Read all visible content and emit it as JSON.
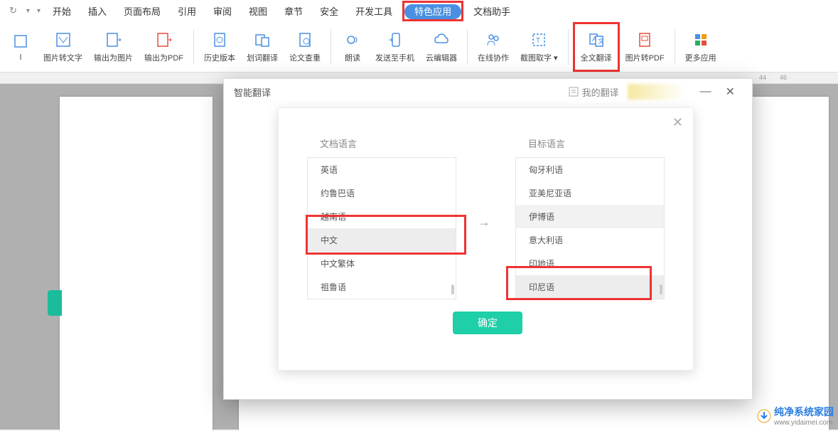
{
  "menu": {
    "items": [
      "开始",
      "插入",
      "页面布局",
      "引用",
      "审阅",
      "视图",
      "章节",
      "安全",
      "开发工具",
      "特色应用",
      "文档助手"
    ],
    "highlighted_index": 9
  },
  "ribbon": {
    "buttons": [
      {
        "label": "图片转文字",
        "icon": "image-text"
      },
      {
        "label": "输出为图片",
        "icon": "export-image"
      },
      {
        "label": "输出为PDF",
        "icon": "export-pdf"
      },
      {
        "label": "历史版本",
        "icon": "history"
      },
      {
        "label": "划词翻译",
        "icon": "word-translate"
      },
      {
        "label": "论文查重",
        "icon": "plagiarism"
      },
      {
        "label": "朗读",
        "icon": "read-aloud"
      },
      {
        "label": "发送至手机",
        "icon": "send-phone"
      },
      {
        "label": "云编辑器",
        "icon": "cloud-edit"
      },
      {
        "label": "在线协作",
        "icon": "collab"
      },
      {
        "label": "截图取字",
        "icon": "screenshot-ocr",
        "dropdown": true
      },
      {
        "label": "全文翻译",
        "icon": "full-translate",
        "highlighted": true
      },
      {
        "label": "图片转PDF",
        "icon": "img-pdf"
      },
      {
        "label": "更多应用",
        "icon": "more-apps"
      }
    ]
  },
  "ruler": {
    "marks": [
      "44",
      "46"
    ]
  },
  "dialog": {
    "title": "智能翻译",
    "my_translations": "我的翻译",
    "source_label": "文档语言",
    "target_label": "目标语言",
    "source_langs": [
      "英语",
      "约鲁巴语",
      "越南语",
      "中文",
      "中文繁体",
      "祖鲁语"
    ],
    "source_selected": "中文",
    "target_langs": [
      "匈牙利语",
      "亚美尼亚语",
      "伊博语",
      "意大利语",
      "印地语",
      "印尼语"
    ],
    "target_selected": "印尼语",
    "target_hover": "伊博语",
    "confirm": "确定"
  },
  "watermark": {
    "brand": "纯净系统家园",
    "url": "www.yidaimei.com"
  },
  "colors": {
    "highlight_blue": "#4a90e2",
    "annotation_red": "#e33",
    "confirm_green": "#1ecfa8"
  }
}
